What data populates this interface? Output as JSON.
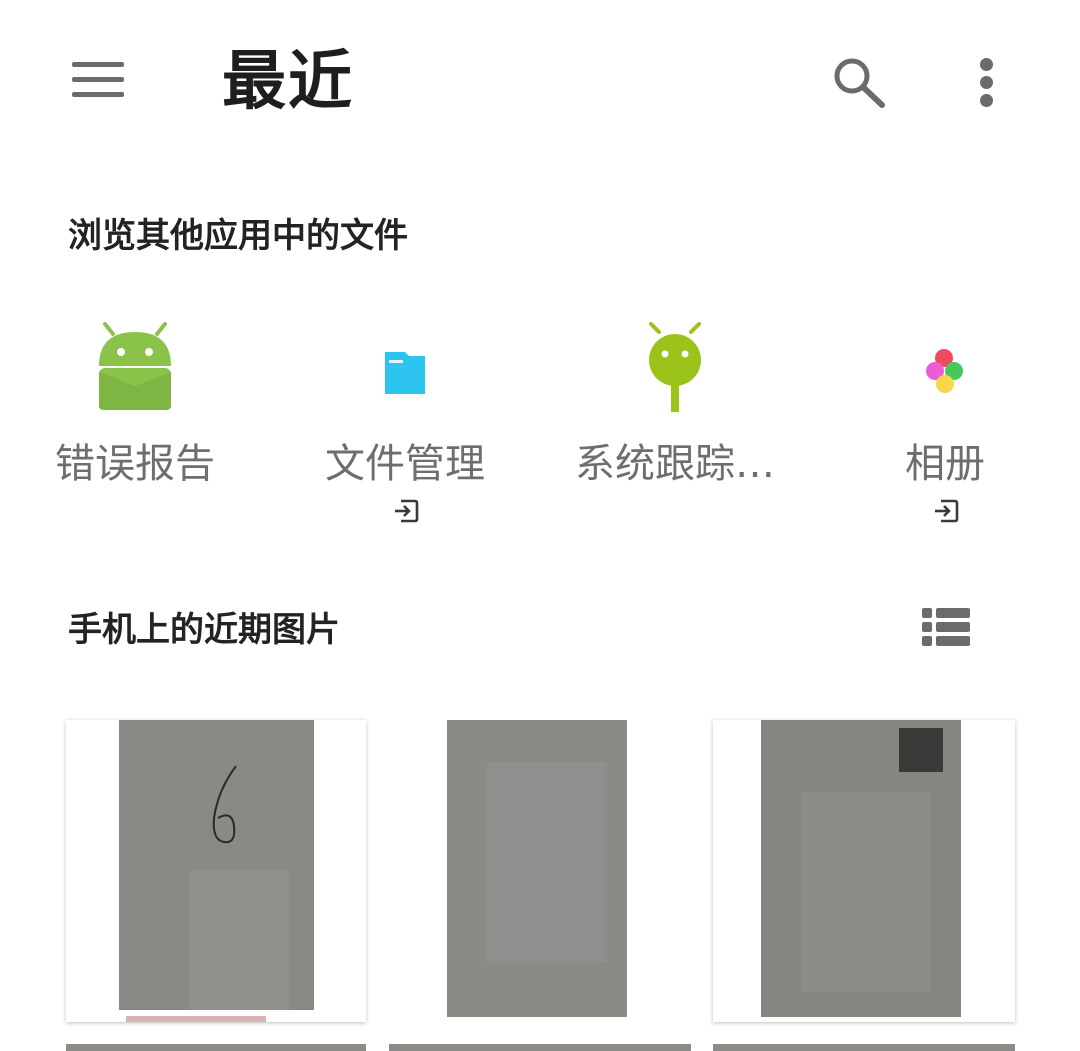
{
  "appbar": {
    "title": "最近",
    "menu_icon": "hamburger-menu-icon",
    "search_icon": "search-icon",
    "more_icon": "more-vert-icon"
  },
  "browse_section": {
    "heading": "浏览其他应用中的文件",
    "apps": [
      {
        "label": "错误报告",
        "icon": "android-icon",
        "icon_color": "#8bc34a",
        "has_open_indicator": false
      },
      {
        "label": "文件管理",
        "icon": "folder-icon",
        "icon_color": "#2ec4f0",
        "has_open_indicator": true
      },
      {
        "label": "系统跟踪…",
        "icon": "android-trace-icon",
        "icon_color": "#9bc31a",
        "has_open_indicator": false
      },
      {
        "label": "相册",
        "icon": "album-flower-icon",
        "icon_color": "#e84a5f",
        "has_open_indicator": true
      }
    ]
  },
  "recent_section": {
    "heading": "手机上的近期图片",
    "view_toggle_icon": "list-view-icon",
    "thumbnails": [
      {
        "handwriting": "6",
        "icon": "photo-thumbnail"
      },
      {
        "handwriting": "",
        "icon": "photo-thumbnail"
      },
      {
        "handwriting": "",
        "icon": "photo-thumbnail"
      }
    ]
  },
  "colors": {
    "icon_gray": "#6b6b6b",
    "label_gray": "#6e6e6e",
    "heading": "#232323",
    "paper_gray": "#8a8986"
  }
}
